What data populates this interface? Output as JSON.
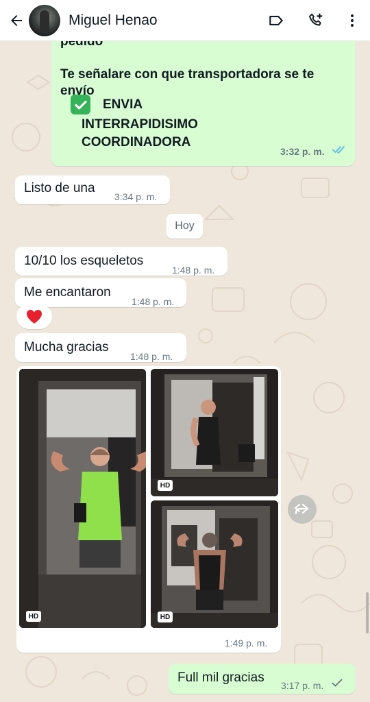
{
  "header": {
    "contact_name": "Miguel Henao",
    "icons": [
      "back-arrow-icon",
      "label-icon",
      "add-call-icon",
      "more-vert-icon"
    ]
  },
  "messages": {
    "m1": {
      "partial_text": "pedido",
      "line1": "Te señalare con que transportadora se te",
      "line2": "envío",
      "envia": "ENVIA",
      "inter": "INTERRAPIDISIMO",
      "coord": "COORDINADORA",
      "time": "3:32 p. m.",
      "status": "read"
    },
    "m2": {
      "text": "Listo de una",
      "time": "3:34 p. m."
    },
    "date_separator": "Hoy",
    "m3": {
      "text": "10/10 los esqueletos",
      "time": "1:48 p. m."
    },
    "m4": {
      "text": "Me encantaron",
      "time": "1:48 p. m.",
      "reaction": "❤️"
    },
    "m5": {
      "text": "Mucha gracias",
      "time": "1:48 p. m."
    },
    "album": {
      "time": "1:49 p. m.",
      "photo_count": 3,
      "hd_label": "HD"
    },
    "m6": {
      "text": "Full mil gracias",
      "time": "3:17 p. m.",
      "status": "sent"
    }
  },
  "colors": {
    "header_bg": "#ffffff",
    "chat_bg": "#efe7dc",
    "incoming_bubble": "#ffffff",
    "outgoing_bubble": "#d9fdd3",
    "read_tick": "#53bdeb",
    "check_box": "#34b35a",
    "tank_top": "#8fe04a"
  }
}
